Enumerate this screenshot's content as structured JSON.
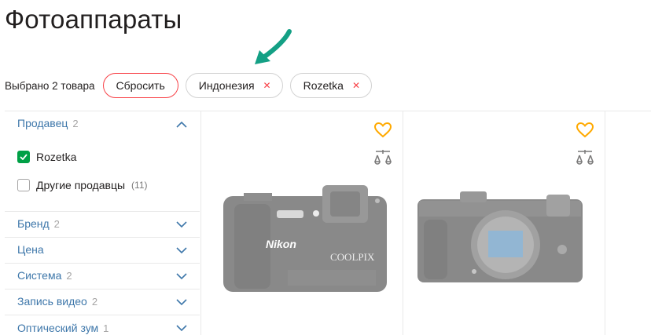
{
  "page": {
    "title": "Фотоаппараты"
  },
  "filters_bar": {
    "selected_text": "Выбрано 2 товара",
    "reset_label": "Сбросить",
    "chips": [
      {
        "label": "Индонезия",
        "remove_icon": "close-icon"
      },
      {
        "label": "Rozetka",
        "remove_icon": "close-icon"
      }
    ]
  },
  "sidebar": {
    "seller": {
      "title": "Продавец",
      "count": "2",
      "expanded": true,
      "options": [
        {
          "label": "Rozetka",
          "checked": true,
          "count": ""
        },
        {
          "label": "Другие продавцы",
          "checked": false,
          "count": "(11)"
        }
      ]
    },
    "groups": [
      {
        "title": "Бренд",
        "count": "2"
      },
      {
        "title": "Цена",
        "count": ""
      },
      {
        "title": "Система",
        "count": "2"
      },
      {
        "title": "Запись видео",
        "count": "2"
      },
      {
        "title": "Оптический зум",
        "count": "1"
      }
    ]
  },
  "products": [
    {
      "image": "camera-image",
      "brand_text": "Nikon",
      "model_text": "COOLPIX",
      "heart_icon": "heart-icon",
      "compare_icon": "compare-scales-icon"
    },
    {
      "image": "camera-image",
      "heart_icon": "heart-icon",
      "compare_icon": "compare-scales-icon"
    }
  ],
  "colors": {
    "accent_green": "#00a046",
    "link_blue": "#3e77aa",
    "reset_red": "#f84147",
    "heart_orange": "#ffa900",
    "arrow_teal": "#14a085"
  }
}
